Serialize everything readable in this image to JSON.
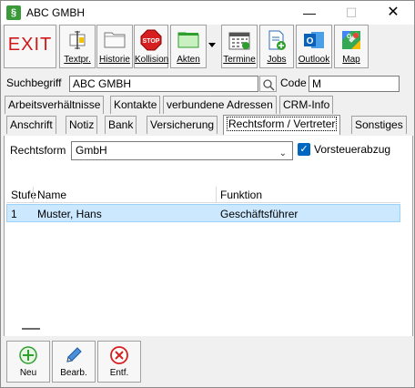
{
  "window": {
    "title": "ABC GMBH",
    "app_icon_glyph": "§",
    "min_glyph": "—",
    "max_glyph": "☐",
    "close_glyph": "✕"
  },
  "toolbar": {
    "exit_label": "EXIT",
    "items": [
      {
        "label": "Textpr.",
        "icon": "text-template-icon"
      },
      {
        "label": "Historie",
        "icon": "folder-icon"
      },
      {
        "label": "Kollision",
        "icon": "stop-sign-icon",
        "stop_text": "STOP"
      },
      {
        "label": "Akten",
        "icon": "green-folder-icon"
      },
      {
        "label": "Termine",
        "icon": "calendar-icon"
      },
      {
        "label": "Jobs",
        "icon": "job-add-icon"
      },
      {
        "label": "Outlook",
        "icon": "outlook-icon",
        "outlook_letter": "O"
      },
      {
        "label": "Map",
        "icon": "map-icon",
        "map_letter": "G"
      }
    ]
  },
  "search": {
    "label": "Suchbegriff",
    "value": "ABC GMBH",
    "code_label": "Code",
    "code_value": "M"
  },
  "tabs_row1": [
    "Arbeitsverhältnisse",
    "Kontakte",
    "verbundene Adressen",
    "CRM-Info"
  ],
  "tabs_row2": [
    "Anschrift",
    "Notiz",
    "Bank",
    "Versicherung",
    "Rechtsform / Vertreter",
    "Sonstiges"
  ],
  "form": {
    "rechtsform_label": "Rechtsform",
    "rechtsform_value": "GmbH",
    "vorsteuer_label": "Vorsteuerabzug",
    "vorsteuer_checked": true
  },
  "grid": {
    "columns": [
      "Stufe",
      "Name",
      "Funktion"
    ],
    "rows": [
      {
        "stufe": "1",
        "name": "Muster, Hans",
        "funktion": "Geschäftsführer"
      }
    ]
  },
  "bottom_buttons": [
    {
      "label": "Neu",
      "icon": "add-icon"
    },
    {
      "label": "Bearb.",
      "icon": "pencil-icon"
    },
    {
      "label": "Entf.",
      "icon": "delete-icon"
    }
  ],
  "colors": {
    "exit_red": "#d01818",
    "selection": "#cce8ff",
    "checkbox_blue": "#0067c0"
  }
}
